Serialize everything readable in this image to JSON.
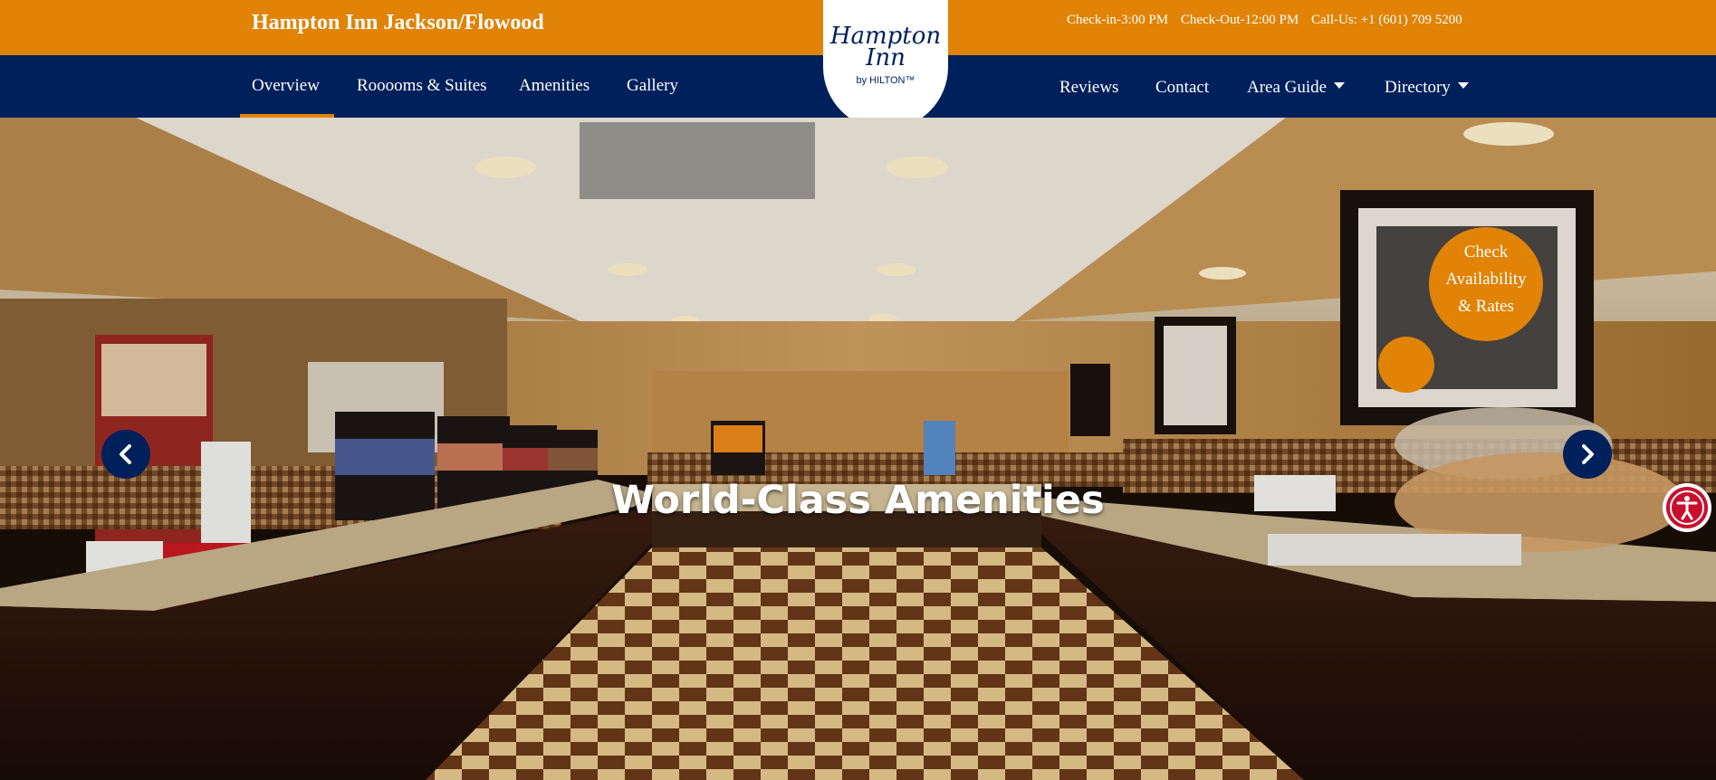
{
  "header": {
    "hotel_name": "Hampton Inn Jackson/Flowood",
    "checkin": "Check-in-3:00 PM",
    "checkout": "Check-Out-12:00 PM",
    "call": "Call-Us: +1 (601) 709 5200"
  },
  "logo": {
    "line1": "Hampton",
    "line2": "Inn",
    "sub": "by HILTON™"
  },
  "nav": {
    "left": [
      "Overview",
      "Rooooms & Suites",
      "Amenities",
      "Gallery"
    ],
    "right": [
      "Reviews",
      "Contact",
      "Area Guide",
      "Directory"
    ],
    "active": "Overview"
  },
  "hero": {
    "title": "World-Class Amenities"
  },
  "cta": {
    "line1": "Check",
    "line2": "Availability",
    "line3": "& Rates"
  },
  "icons": {
    "prev": "chevron-left-icon",
    "next": "chevron-right-icon",
    "accessibility": "accessibility-icon"
  },
  "colors": {
    "brand_orange": "#e08307",
    "brand_navy": "#00205b",
    "accessibility_red": "#c8102e"
  }
}
